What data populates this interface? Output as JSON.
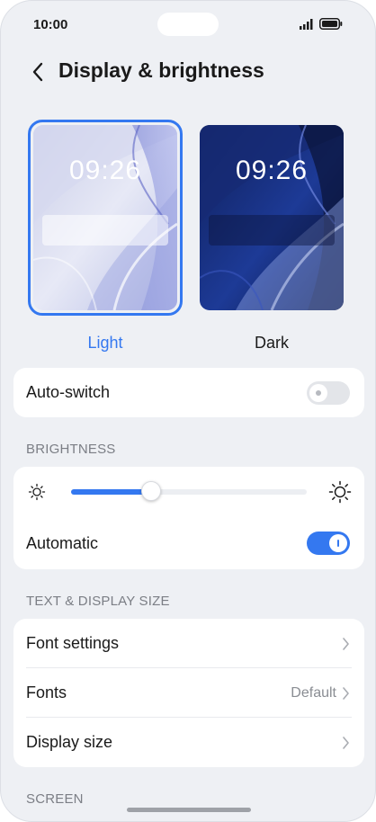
{
  "status_bar": {
    "time": "10:00",
    "signal_icon": "signal-bars-icon",
    "battery_icon": "battery-icon"
  },
  "header": {
    "back_icon": "chevron-left-icon",
    "title": "Display & brightness"
  },
  "themes": {
    "light": {
      "label": "Light",
      "preview_time": "09:26",
      "selected": true
    },
    "dark": {
      "label": "Dark",
      "preview_time": "09:26",
      "selected": false
    }
  },
  "auto_switch": {
    "label": "Auto-switch",
    "enabled": false
  },
  "brightness": {
    "section_title": "BRIGHTNESS",
    "level": 0.34,
    "low_icon": "sun-small-icon",
    "high_icon": "sun-large-icon",
    "automatic_label": "Automatic",
    "automatic_enabled": true
  },
  "text_display": {
    "section_title": "TEXT & DISPLAY SIZE",
    "items": [
      {
        "label": "Font settings",
        "value": ""
      },
      {
        "label": "Fonts",
        "value": "Default"
      },
      {
        "label": "Display size",
        "value": ""
      }
    ]
  },
  "screen": {
    "section_title": "SCREEN"
  },
  "colors": {
    "accent": "#3478f0",
    "background": "#eef0f4"
  }
}
